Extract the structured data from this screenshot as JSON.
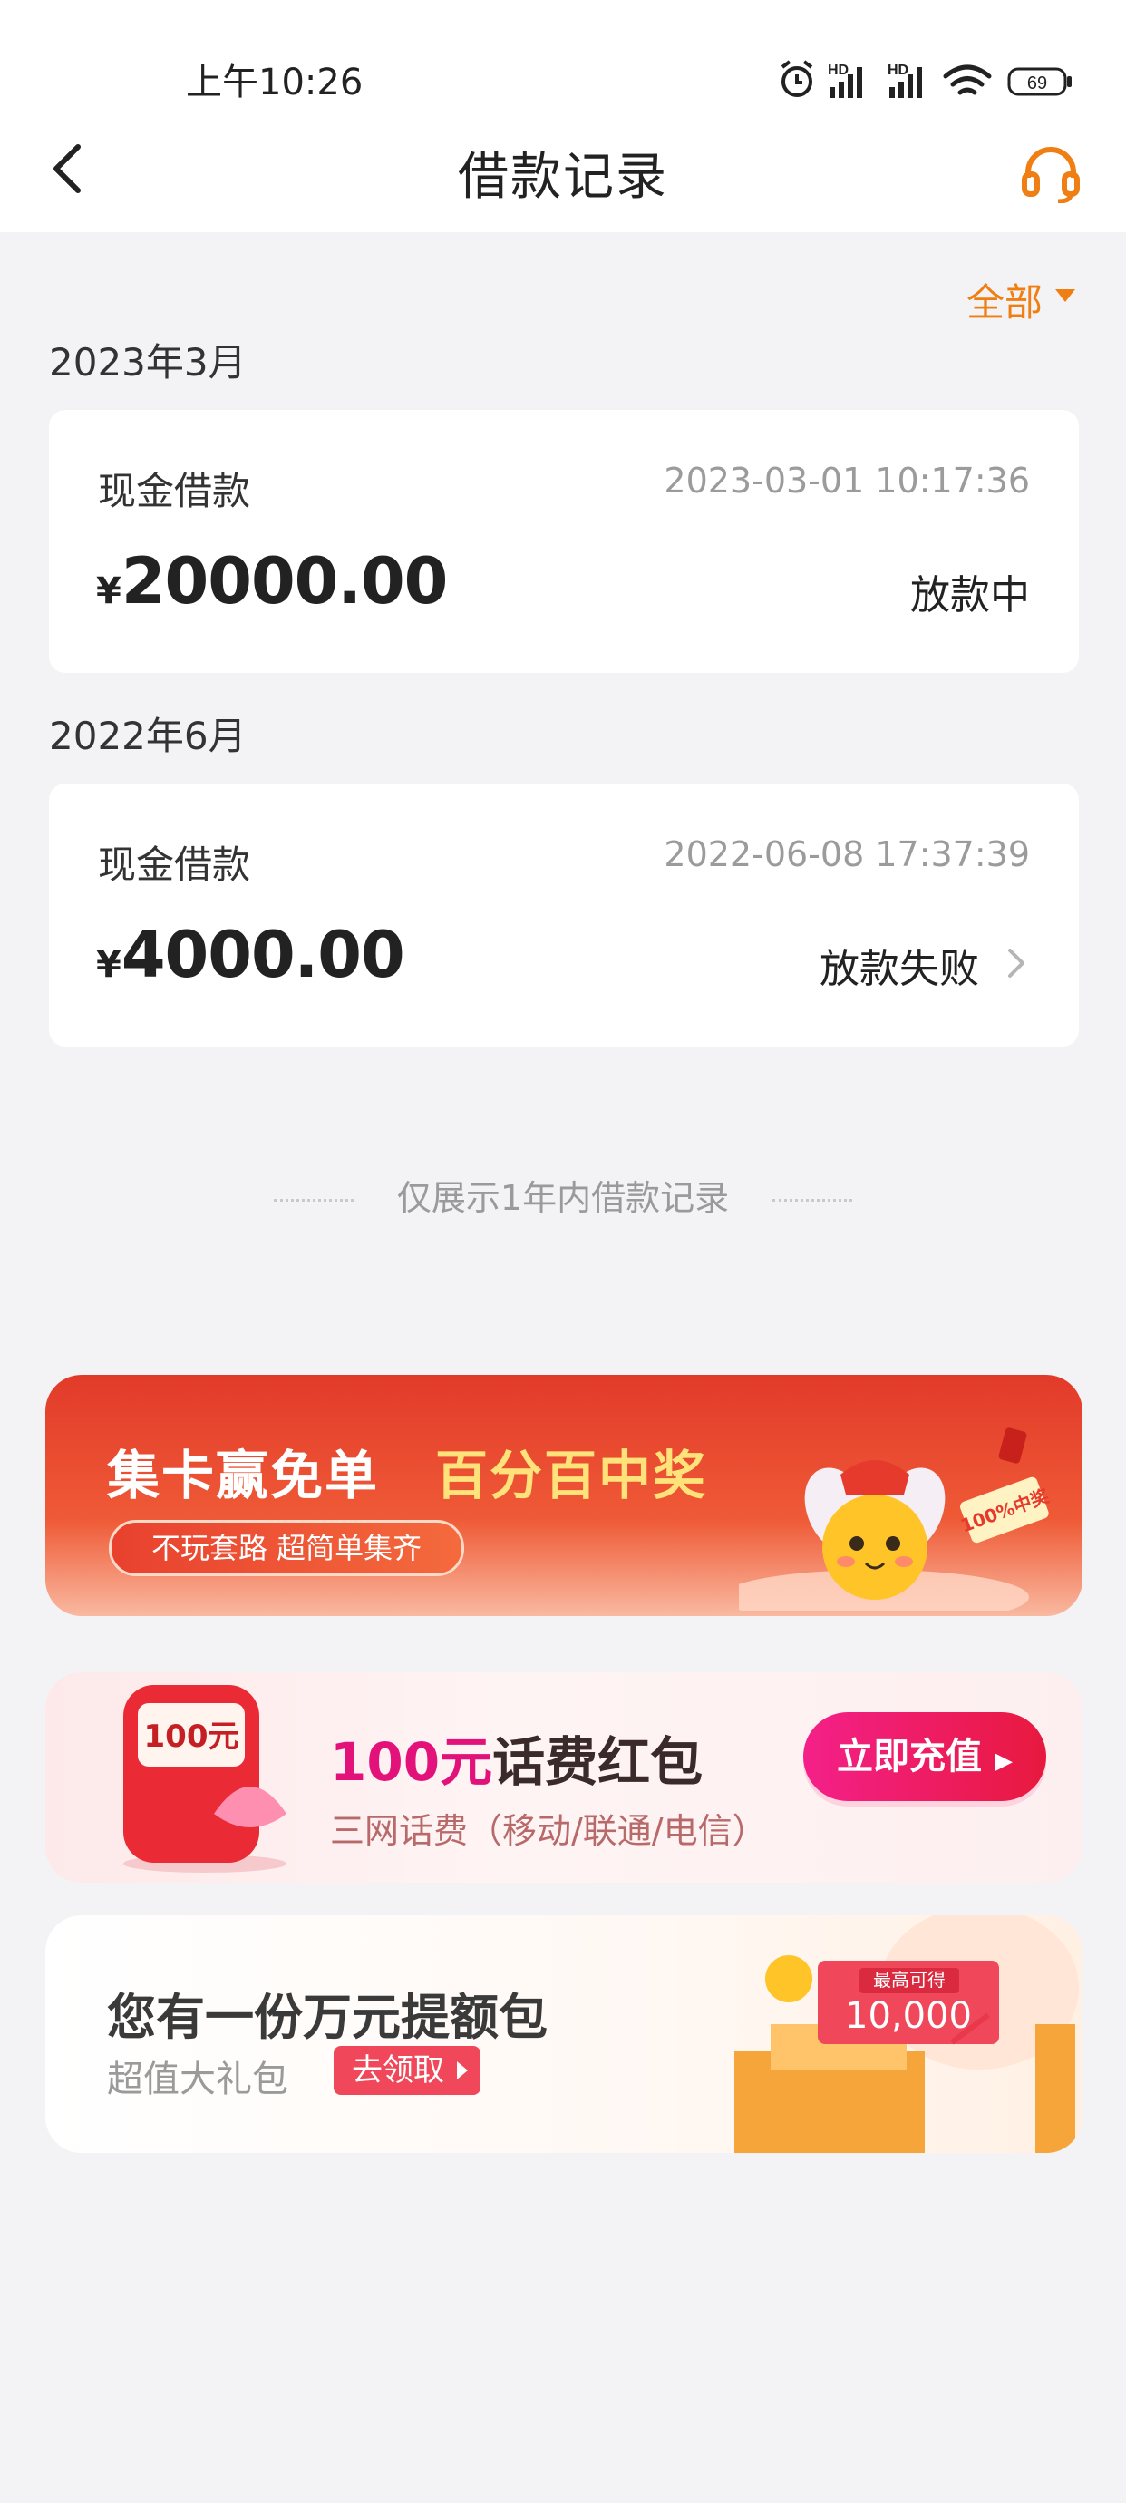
{
  "status_bar": {
    "time": "上午10:26",
    "battery": "69",
    "network_labels": [
      "HD",
      "HD"
    ]
  },
  "nav": {
    "title": "借款记录"
  },
  "filter": {
    "label": "全部"
  },
  "groups": [
    {
      "month": "2023年3月",
      "record": {
        "kind": "现金借款",
        "time": "2023-03-01 10:17:36",
        "currency": "¥",
        "amount": "20000.00",
        "status": "放款中"
      }
    },
    {
      "month": "2022年6月",
      "record": {
        "kind": "现金借款",
        "time": "2022-06-08 17:37:39",
        "currency": "¥",
        "amount": "4000.00",
        "status": "放款失败"
      }
    }
  ],
  "note": "仅展示1年内借款记录",
  "banners": {
    "card_collect": {
      "title_white": "集卡赢免单",
      "title_yellow": "百分百中奖",
      "pill": "不玩套路 超简单集齐",
      "badge": "100%中奖"
    },
    "phone_bill": {
      "pack_label": "100元",
      "title_highlight": "100元",
      "title_rest": "话费红包",
      "subtitle": "三网话费（移动/联通/电信）",
      "button": "立即充值"
    },
    "credit_pack": {
      "title": "您有一份万元提额包",
      "subtitle": "超值大礼包",
      "tag": "去领取",
      "ticket_top": "最高可得",
      "ticket_amount": "10,000"
    }
  },
  "colors": {
    "accent": "#f07f13",
    "page_bg": "#f3f3f5",
    "pink": "#e3127a",
    "red": "#e23a2a"
  },
  "icons": [
    "back-arrow-icon",
    "headset-icon",
    "alarm-icon",
    "signal-icon",
    "wifi-icon",
    "battery-icon",
    "chevron-right-icon"
  ]
}
